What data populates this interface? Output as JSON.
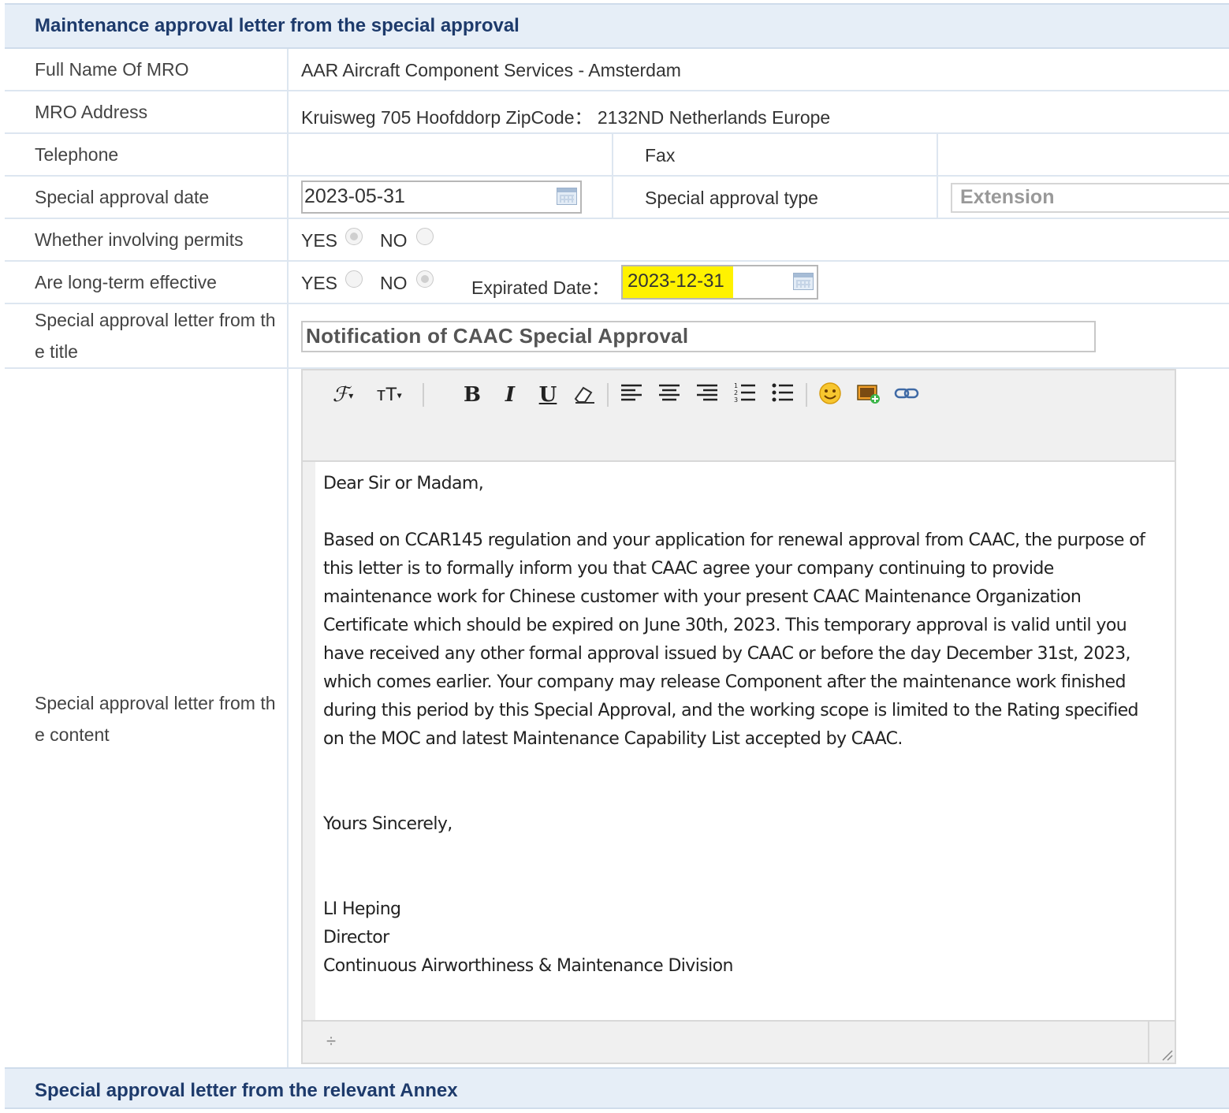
{
  "section_main": {
    "title": "Maintenance approval letter from the special approval"
  },
  "fields": {
    "full_name_label": "Full Name Of MRO",
    "full_name_value": "AAR Aircraft Component Services - Amsterdam",
    "address_label": "MRO Address",
    "address_value": "Kruisweg 705 Hoofddorp  ZipCode： 2132ND Netherlands Europe",
    "telephone_label": "Telephone",
    "telephone_value": "",
    "fax_label": "Fax",
    "fax_value": "",
    "approval_date_label": "Special approval date",
    "approval_date_value": "2023-05-31",
    "approval_type_label": "Special approval type",
    "approval_type_value": "Extension",
    "permits_label": "Whether involving permits",
    "permits_yes": "YES",
    "permits_no": "NO",
    "permits_selected": "YES",
    "longterm_label": "Are long-term effective",
    "longterm_yes": "YES",
    "longterm_no": "NO",
    "longterm_selected": "NO",
    "expirated_label": "Expirated Date：",
    "expirated_value": "2023-12-31",
    "title_label_1": "Special approval letter from th",
    "title_label_2": "e title",
    "title_value": "Notification of CAAC Special Approval",
    "content_label_1": "Special approval letter from th",
    "content_label_2": "e content"
  },
  "toolbar": {
    "font_family": "ℱ",
    "font_size": "ᴛT",
    "bold": "B",
    "italic": "I",
    "underline": "U"
  },
  "editor": {
    "greeting": "Dear Sir or Madam,",
    "body_lines": [
      "Based on CCAR145 regulation and your application for renewal approval from CAAC, the purpose of",
      "this letter is to formally inform you that CAAC agree your company continuing to provide",
      "maintenance work for Chinese customer with your present CAAC Maintenance Organization",
      "Certificate which should be expired on June 30th, 2023. This temporary approval is valid until you",
      "have received any other formal approval issued by CAAC or before the day December 31st, 2023,",
      "which comes earlier. Your company may release Component after the maintenance work finished",
      "during this period by this Special Approval, and the working scope is limited to the Rating specified",
      "on the MOC and latest Maintenance Capability List accepted by CAAC."
    ],
    "closing": "Yours Sincerely,",
    "signature_name": "LI Heping",
    "signature_title": "Director",
    "signature_division": "Continuous Airworthiness & Maintenance Division"
  },
  "section_annex": {
    "title": "Special approval letter from the relevant Annex"
  },
  "colors": {
    "header_bg": "#e6eef7",
    "header_text": "#1d3a6b",
    "highlight": "#fff200"
  }
}
